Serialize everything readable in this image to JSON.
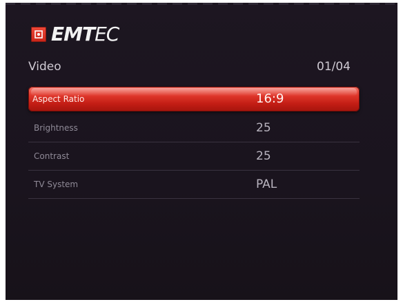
{
  "brand": {
    "name_bold": "EMT",
    "name_light": "EC",
    "icon": "emtec-logo-icon",
    "accent_color": "#d8281c"
  },
  "header": {
    "section_title": "Video",
    "page_counter": "01/04"
  },
  "menu": {
    "items": [
      {
        "label": "Aspect Ratio",
        "value": "16:9",
        "selected": true
      },
      {
        "label": "Brightness",
        "value": "25",
        "selected": false
      },
      {
        "label": "Contrast",
        "value": "25",
        "selected": false
      },
      {
        "label": "TV System",
        "value": "PAL",
        "selected": false
      }
    ]
  }
}
